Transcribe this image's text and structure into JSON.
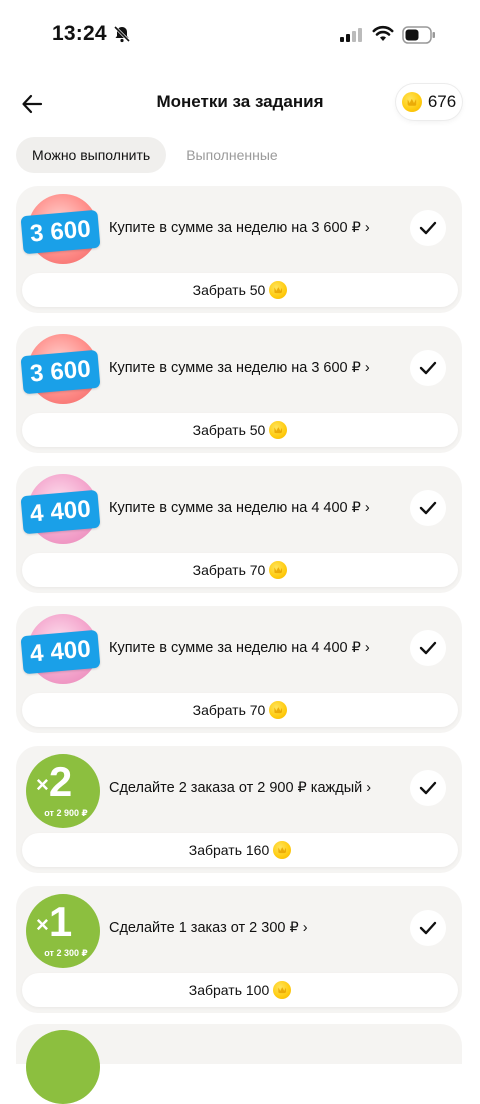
{
  "status_bar": {
    "time": "13:24",
    "icons": [
      "bell-slash-icon",
      "cellular-signal-icon",
      "wifi-icon",
      "battery-icon"
    ]
  },
  "header": {
    "back_icon": "arrow-left-icon",
    "title": "Монетки за задания",
    "balance": "676",
    "balance_icon": "coin-icon"
  },
  "tabs": [
    {
      "label": "Можно выполнить",
      "active": true
    },
    {
      "label": "Выполненные",
      "active": false
    }
  ],
  "tasks": [
    {
      "badge_type": "amount",
      "badge_color": "red",
      "badge_text": "3 600",
      "title": "Купите в сумме за неделю на 3 600 ₽ ›",
      "claim_label": "Забрать 50"
    },
    {
      "badge_type": "amount",
      "badge_color": "red",
      "badge_text": "3 600",
      "title": "Купите в сумме за неделю на 3 600 ₽ ›",
      "claim_label": "Забрать 50"
    },
    {
      "badge_type": "amount",
      "badge_color": "pink",
      "badge_text": "4 400",
      "title": "Купите в сумме за неделю на 4 400 ₽ ›",
      "claim_label": "Забрать 70"
    },
    {
      "badge_type": "amount",
      "badge_color": "pink",
      "badge_text": "4 400",
      "title": "Купите в сумме за неделю на 4 400 ₽ ›",
      "claim_label": "Забрать 70"
    },
    {
      "badge_type": "orders",
      "badge_color": "green",
      "badge_multiplier": "×",
      "badge_count": "2",
      "badge_sub": "от 2 900 ₽",
      "title": "Сделайте 2 заказа от 2 900 ₽ каждый ›",
      "claim_label": "Забрать 160"
    },
    {
      "badge_type": "orders",
      "badge_color": "green",
      "badge_multiplier": "×",
      "badge_count": "1",
      "badge_sub": "от 2 300 ₽",
      "title": "Сделайте 1 заказ от 2 300 ₽ ›",
      "claim_label": "Забрать 100"
    }
  ],
  "colors": {
    "card_bg": "#f5f4f2",
    "badge_blue": "#1aa0e8",
    "green": "#8cbf3f",
    "coin": "#ffcb0f"
  }
}
